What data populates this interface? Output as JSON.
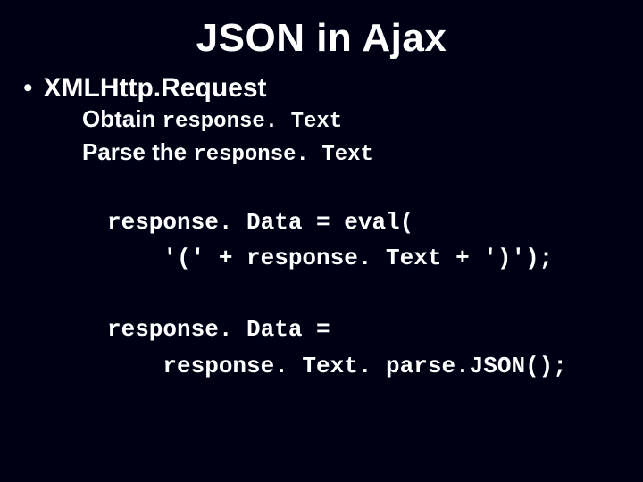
{
  "title": "JSON in Ajax",
  "bullet": {
    "dot": "•",
    "text": "XMLHttp.Request"
  },
  "sub1": {
    "prefix": "Obtain ",
    "code": "response. Text"
  },
  "sub2": {
    "prefix": "Parse the ",
    "code": "response. Text"
  },
  "code1": "response. Data = eval(\n    '(' + response. Text + ')');",
  "code2": "response. Data =\n    response. Text. parse.JSON();"
}
